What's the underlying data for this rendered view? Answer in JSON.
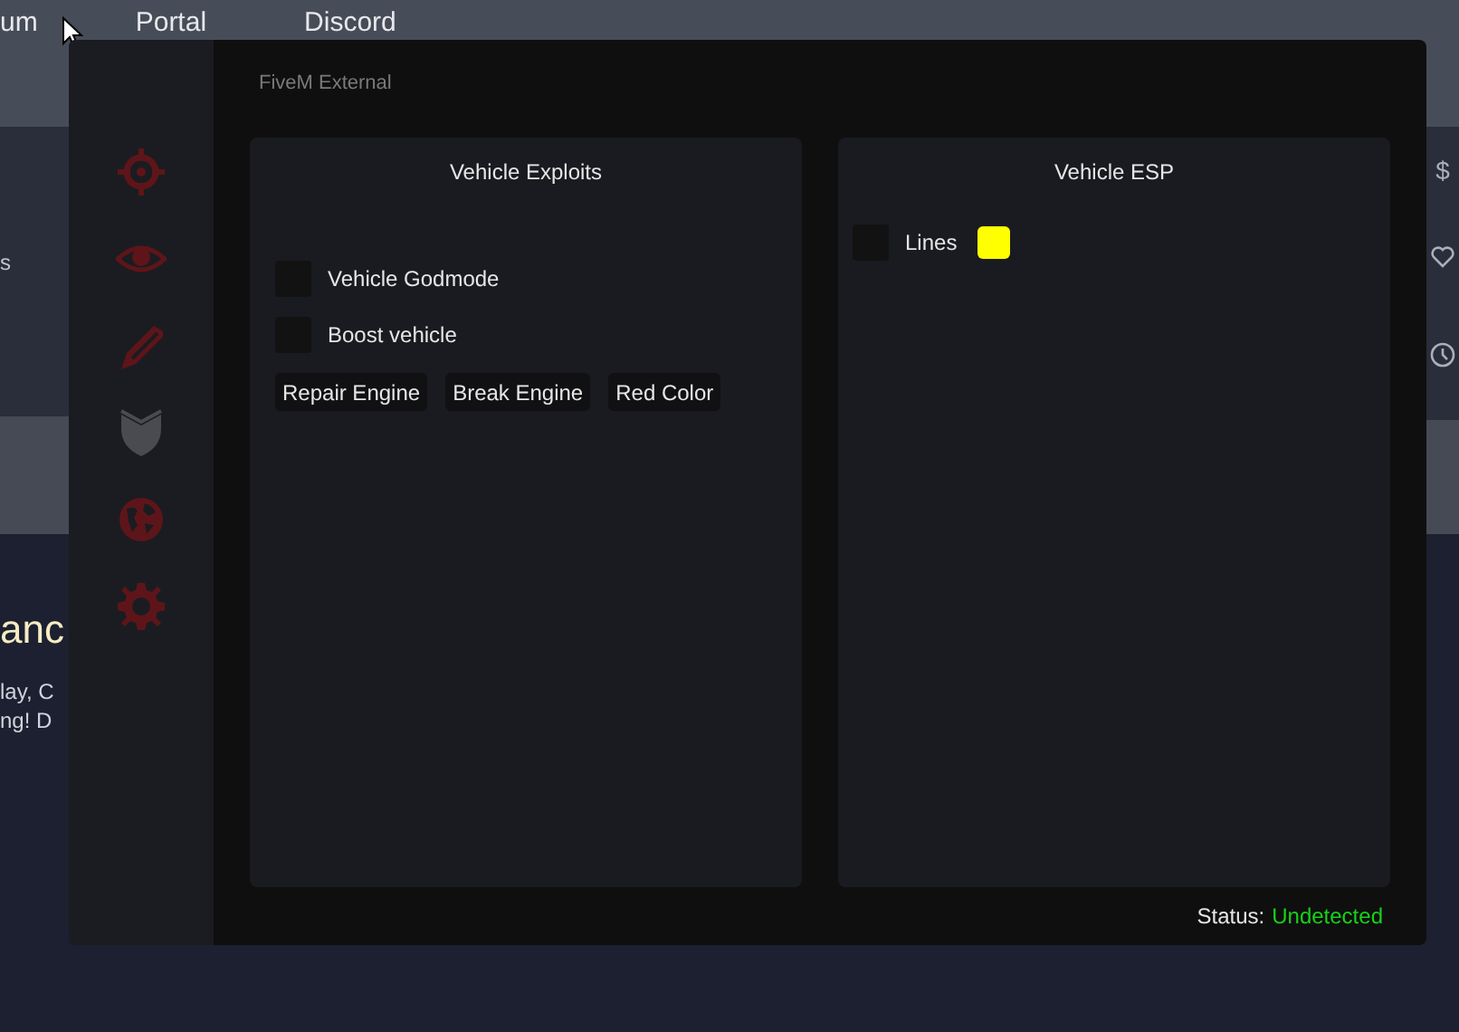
{
  "background_page": {
    "nav": [
      "um",
      "Portal",
      "Discord"
    ],
    "fragments": [
      "s",
      "anc",
      "lay, C",
      "ng! D"
    ],
    "side_marks": [
      "$"
    ]
  },
  "window": {
    "title": "FiveM External"
  },
  "sidebar_tabs": [
    {
      "selected": false
    },
    {
      "selected": false
    },
    {
      "selected": false
    },
    {
      "selected": true
    },
    {
      "selected": false
    },
    {
      "selected": false
    }
  ],
  "panels": [
    {
      "title": "Vehicle Exploits",
      "items": [
        {
          "kind": "checkbox",
          "label": "Vehicle Godmode",
          "checked": false
        },
        {
          "kind": "checkbox",
          "label": "Boost vehicle",
          "checked": false
        }
      ],
      "buttons": [
        "Repair Engine",
        "Break Engine",
        "Red Color"
      ]
    },
    {
      "title": "Vehicle ESP",
      "items": [
        {
          "kind": "checkbox",
          "label": "Lines",
          "checked": false,
          "color": "#ffff00"
        }
      ]
    }
  ],
  "status": {
    "label": "Status:",
    "value": "Undetected"
  }
}
